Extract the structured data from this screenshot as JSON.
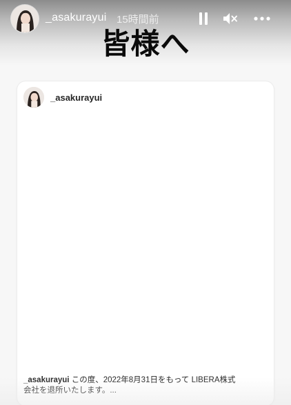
{
  "story": {
    "username": "_asakurayui",
    "time_ago": "15時間前",
    "title": "皆様へ",
    "controls": {
      "pause_icon": "pause-icon",
      "mute_icon": "muted-speaker-icon",
      "more_icon": "more-horizontal-icon"
    }
  },
  "post": {
    "username": "_asakurayui",
    "caption_user": "_asakurayui",
    "caption_line1": "この度、2022年8月31日をもって LIBERA株式",
    "caption_line2": "会社を退所いたします。..."
  },
  "colors": {
    "header_text": "#ffffff",
    "title_text": "#0b0b0b",
    "card_bg": "#ffffff",
    "caption_text": "#262626"
  }
}
